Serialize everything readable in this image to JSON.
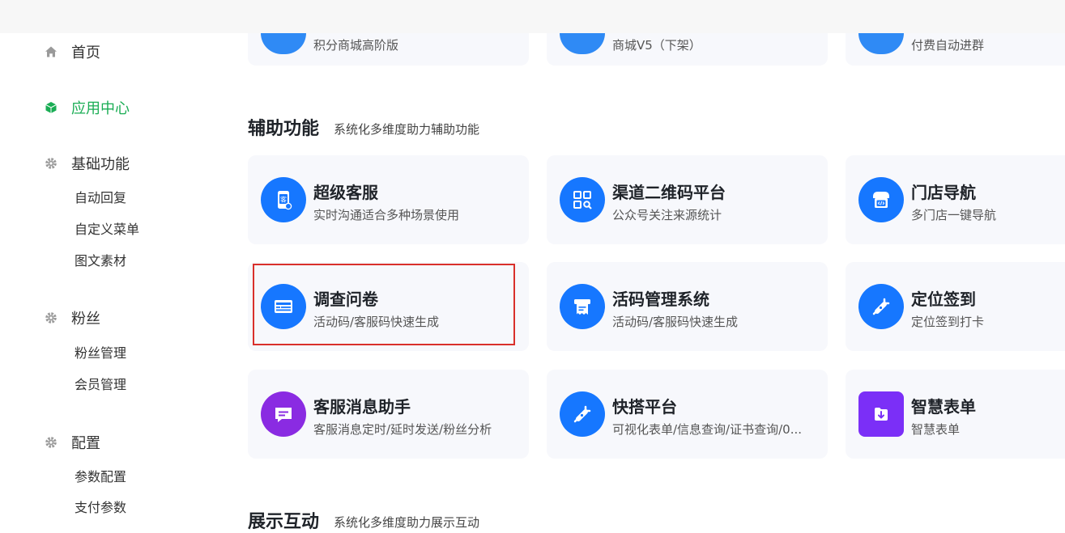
{
  "sidebar": {
    "home": "首页",
    "app_center": "应用中心",
    "basic": {
      "label": "基础功能",
      "items": [
        "自动回复",
        "自定义菜单",
        "图文素材"
      ]
    },
    "fans": {
      "label": "粉丝",
      "items": [
        "粉丝管理",
        "会员管理"
      ]
    },
    "config": {
      "label": "配置",
      "items": [
        "参数配置",
        "支付参数"
      ]
    }
  },
  "top_row": [
    {
      "desc": "积分商城高阶版"
    },
    {
      "desc": "商城V5（下架）"
    },
    {
      "desc": "付费自动进群"
    }
  ],
  "section_aux": {
    "title": "辅助功能",
    "subtitle": "系统化多维度助力辅助功能",
    "cards": [
      {
        "title": "超级客服",
        "desc": "实时沟通适合多种场景使用",
        "icon": "customer-service-icon",
        "color": "#1677ff"
      },
      {
        "title": "渠道二维码平台",
        "desc": "公众号关注来源统计",
        "icon": "qrcode-icon",
        "color": "#1677ff"
      },
      {
        "title": "门店导航",
        "desc": "多门店一键导航",
        "icon": "store-icon",
        "color": "#1677ff"
      },
      {
        "title": "调查问卷",
        "desc": "活动码/客服码快速生成",
        "icon": "survey-icon",
        "color": "#1677ff"
      },
      {
        "title": "活码管理系统",
        "desc": "活动码/客服码快速生成",
        "icon": "printer-icon",
        "color": "#1677ff"
      },
      {
        "title": "定位签到",
        "desc": "定位签到打卡",
        "icon": "location-icon",
        "color": "#1677ff"
      },
      {
        "title": "客服消息助手",
        "desc": "客服消息定时/延时发送/粉丝分析",
        "icon": "message-icon",
        "color": "#8a2be2"
      },
      {
        "title": "快搭平台",
        "desc": "可视化表单/信息查询/证书查询/0...",
        "icon": "plug-icon",
        "color": "#1677ff"
      },
      {
        "title": "智慧表单",
        "desc": "智慧表单",
        "icon": "form-download-icon",
        "color": "#7b2ff7"
      }
    ]
  },
  "section_display": {
    "title": "展示互动",
    "subtitle": "系统化多维度助力展示互动"
  }
}
